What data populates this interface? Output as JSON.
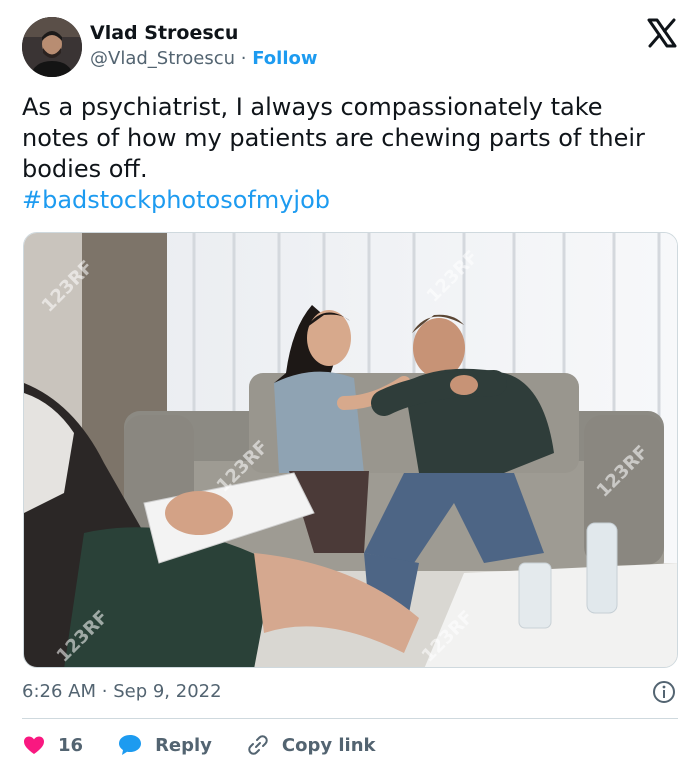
{
  "author": {
    "display_name": "Vlad Stroescu",
    "handle": "@Vlad_Stroescu",
    "separator": "·",
    "follow_label": "Follow"
  },
  "tweet": {
    "text": "As a psychiatrist, I always compassionately take notes of how my patients are chewing parts of their bodies off.",
    "hashtag": "#badstockphotosofmyjob",
    "time": "6:26 AM",
    "date_separator": "·",
    "date": "Sep 9, 2022"
  },
  "media": {
    "watermark": "123RF"
  },
  "actions": {
    "like_count": "16",
    "reply_label": "Reply",
    "copy_link_label": "Copy link"
  },
  "colors": {
    "accent": "#1d9bf0",
    "like": "#f91880",
    "text": "#0f1419",
    "muted": "#536471"
  },
  "icons": [
    "x-logo-icon",
    "info-icon",
    "heart-icon",
    "reply-bubble-icon",
    "link-icon"
  ]
}
